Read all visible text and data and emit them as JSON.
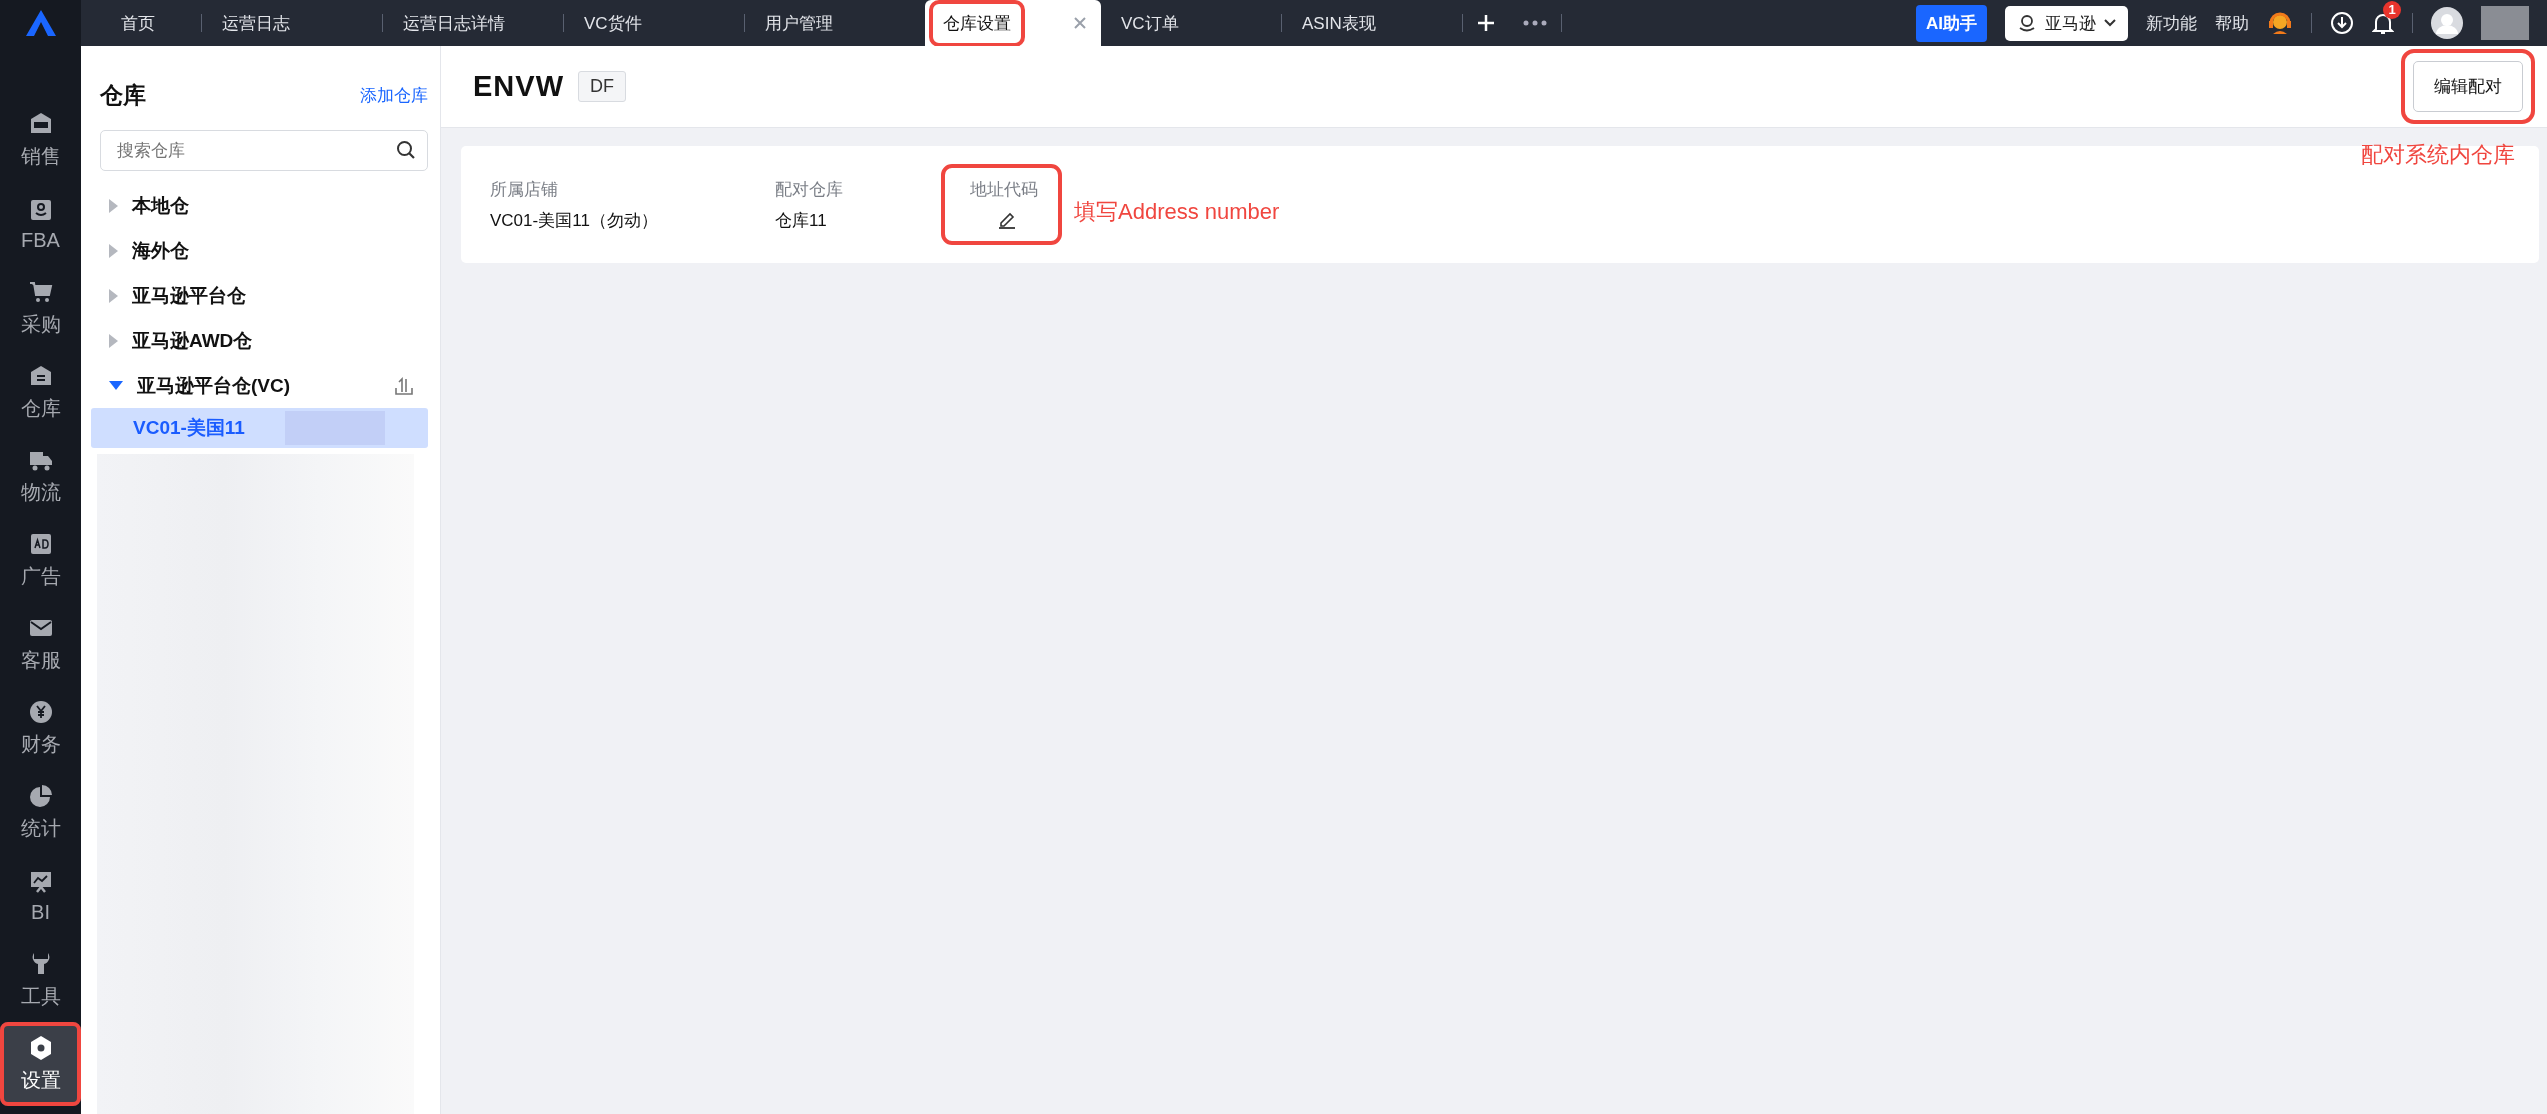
{
  "top_bar": {
    "tabs": [
      {
        "label": "首页",
        "selected": false,
        "highlighted": false
      },
      {
        "label": "运营日志",
        "selected": false,
        "highlighted": false
      },
      {
        "label": "运营日志详情",
        "selected": false,
        "highlighted": false
      },
      {
        "label": "VC货件",
        "selected": false,
        "highlighted": false
      },
      {
        "label": "用户管理",
        "selected": false,
        "highlighted": false
      },
      {
        "label": "仓库设置",
        "selected": true,
        "highlighted": true
      },
      {
        "label": "VC订单",
        "selected": false,
        "highlighted": false
      },
      {
        "label": "ASIN表现",
        "selected": false,
        "highlighted": false
      }
    ],
    "ai_button": "AI助手",
    "platform_select": "亚马逊",
    "links": [
      "新功能",
      "帮助"
    ],
    "notification_badge": "1"
  },
  "nav": {
    "items": [
      {
        "label": "销售",
        "kind": "sales",
        "selected": false,
        "highlighted": false
      },
      {
        "label": "FBA",
        "kind": "fba",
        "selected": false,
        "highlighted": false
      },
      {
        "label": "采购",
        "kind": "cart",
        "selected": false,
        "highlighted": false
      },
      {
        "label": "仓库",
        "kind": "warehouse",
        "selected": false,
        "highlighted": false
      },
      {
        "label": "物流",
        "kind": "truck",
        "selected": false,
        "highlighted": false
      },
      {
        "label": "广告",
        "kind": "ad",
        "selected": false,
        "highlighted": false
      },
      {
        "label": "客服",
        "kind": "mail",
        "selected": false,
        "highlighted": false
      },
      {
        "label": "财务",
        "kind": "yen",
        "selected": false,
        "highlighted": false
      },
      {
        "label": "统计",
        "kind": "pie",
        "selected": false,
        "highlighted": false
      },
      {
        "label": "BI",
        "kind": "board",
        "selected": false,
        "highlighted": false
      },
      {
        "label": "工具",
        "kind": "wrench",
        "selected": false,
        "highlighted": false
      },
      {
        "label": "设置",
        "kind": "gear",
        "selected": true,
        "highlighted": true
      }
    ]
  },
  "sidebar": {
    "title": "仓库",
    "add_link": "添加仓库",
    "search": {
      "placeholder": "搜索仓库"
    },
    "tree": [
      {
        "label": "本地仓",
        "expanded": false,
        "upload_button": false
      },
      {
        "label": "海外仓",
        "expanded": false,
        "upload_button": false
      },
      {
        "label": "亚马逊平台仓",
        "expanded": false,
        "upload_button": false
      },
      {
        "label": "亚马逊AWD仓",
        "expanded": false,
        "upload_button": false
      },
      {
        "label": "亚马逊平台仓(VC)",
        "expanded": true,
        "upload_button": true,
        "children": [
          {
            "label": "VC01-美国11",
            "selected": true
          }
        ]
      }
    ]
  },
  "header": {
    "title": "ENVW",
    "tag": "DF",
    "button": "编辑配对",
    "button_highlighted": true
  },
  "card": {
    "fields": [
      {
        "label": "所属店铺",
        "kind": "text",
        "value": "VC01-美国11（勿动）",
        "highlighted": false
      },
      {
        "label": "配对仓库",
        "kind": "text",
        "value": "仓库11",
        "highlighted": false
      },
      {
        "label": "地址代码",
        "kind": "edit",
        "highlighted": true
      }
    ]
  },
  "annotations": {
    "field_note": "填写Address number",
    "button_note": "配对系统内仓库"
  }
}
